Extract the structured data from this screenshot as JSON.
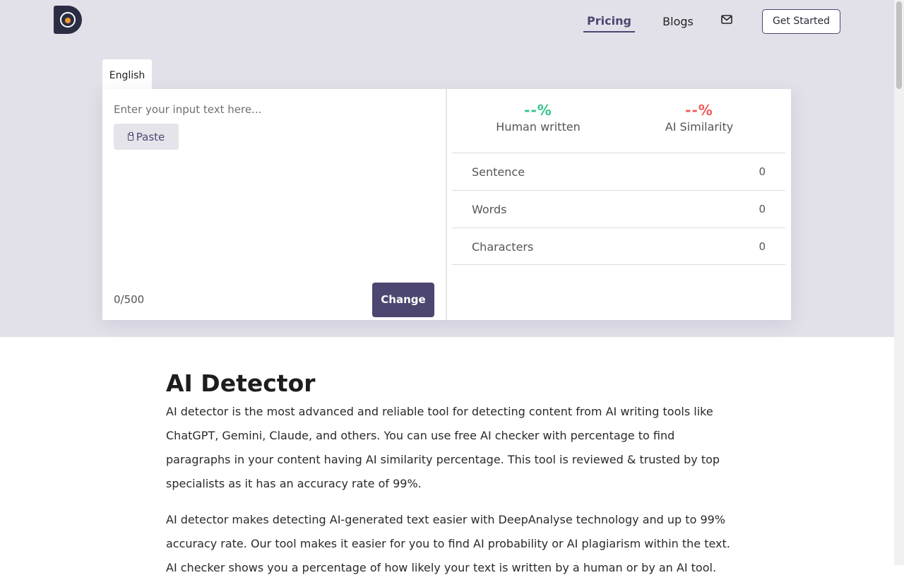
{
  "header": {
    "logo_name": "logo",
    "nav": {
      "pricing": "Pricing",
      "blogs": "Blogs"
    },
    "mail_icon": "mail-icon",
    "cta": "Get Started"
  },
  "tool": {
    "language_tab": "English",
    "input": {
      "placeholder": "Enter your input text here...",
      "value": ""
    },
    "paste_label": "Paste",
    "counter": "0/500",
    "change_label": "Change",
    "human": {
      "percent": "--%",
      "label": "Human written"
    },
    "ai": {
      "percent": "--%",
      "label": "AI Similarity"
    },
    "stats": [
      {
        "label": "Sentence",
        "value": "0"
      },
      {
        "label": "Words",
        "value": "0"
      },
      {
        "label": "Characters",
        "value": "0"
      }
    ]
  },
  "article": {
    "title": "AI Detector",
    "paragraphs": [
      "AI detector is the most advanced and reliable tool for detecting content from AI writing tools like ChatGPT, Gemini, Claude, and others. You can use free AI checker with percentage to find paragraphs in your content having AI similarity percentage. This tool is reviewed & trusted by top specialists as it has an accuracy rate of 99%.",
      "AI detector makes detecting AI-generated text easier with DeepAnalyse technology and up to 99% accuracy rate. Our tool makes it easier for you to find AI probability or AI plagiarism within the text. AI checker shows you a percentage of how likely your text is written by a human or by an AI tool."
    ]
  },
  "colors": {
    "brand": "#4b4770",
    "human": "#33c58a",
    "ai": "#ef5b5b",
    "hero_bg": "#e2e1ea"
  }
}
